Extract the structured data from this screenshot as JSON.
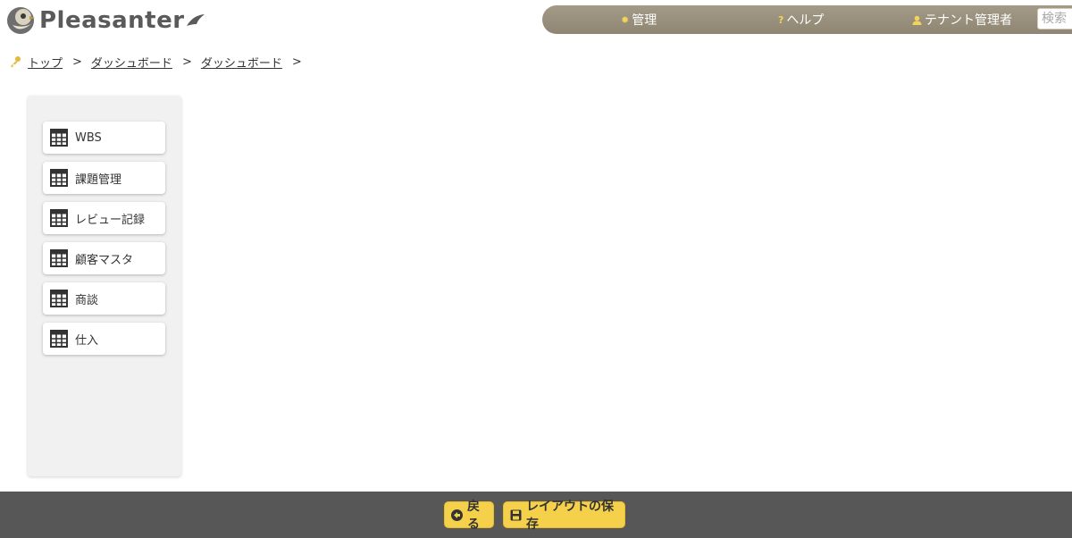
{
  "app": {
    "logo_text": "Pleasanter",
    "logo_icon": "sparrow-logo-icon"
  },
  "topbar": {
    "admin": {
      "label": "管理",
      "icon": "gear-icon"
    },
    "help": {
      "label": "ヘルプ",
      "icon": "question-icon"
    },
    "tenant": {
      "label": "テナント管理者",
      "icon": "user-icon"
    },
    "search": {
      "placeholder": "検索"
    }
  },
  "breadcrumb": {
    "icon": "key-icon",
    "items": [
      {
        "label": "トップ"
      },
      {
        "label": "ダッシュボード"
      },
      {
        "label": "ダッシュボード"
      }
    ],
    "separator": ">"
  },
  "menu": {
    "items": [
      {
        "label": "WBS",
        "icon": "table-icon"
      },
      {
        "label": "課題管理",
        "icon": "table-icon"
      },
      {
        "label": "レビュー記録",
        "icon": "table-icon"
      },
      {
        "label": "顧客マスタ",
        "icon": "table-icon"
      },
      {
        "label": "商談",
        "icon": "table-icon"
      },
      {
        "label": "仕入",
        "icon": "table-icon"
      }
    ]
  },
  "footer": {
    "back": {
      "label": "戻る",
      "icon": "back-arrow-icon"
    },
    "save_layout": {
      "label": "レイアウトの保存",
      "icon": "save-icon"
    }
  },
  "colors": {
    "topbar": "#9a927e",
    "footer": "#575757",
    "button": "#f5d04a",
    "panel": "#f1f1f1"
  }
}
